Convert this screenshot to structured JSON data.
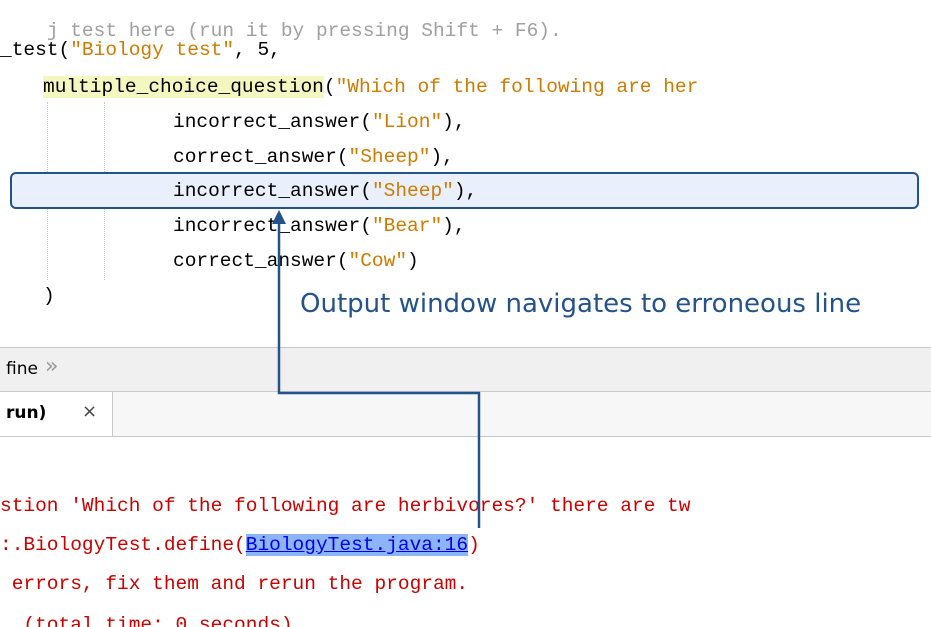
{
  "editor": {
    "cutoff_line": "j test here (run it by pressing Shift + F6).",
    "test_call_prefix": "_test(",
    "test_title": "\"Biology test\"",
    "test_args_suffix": ", 5,",
    "question_method": "multiple_choice_question",
    "question_paren": "(",
    "question_text": "\"Which of the following are her",
    "answers": [
      {
        "method": "incorrect_answer(",
        "value": "\"Lion\"",
        "suffix": "),"
      },
      {
        "method": "correct_answer(",
        "value": "\"Sheep\"",
        "suffix": "),"
      },
      {
        "method": "incorrect_answer(",
        "value": "\"Sheep\"",
        "suffix": "),"
      },
      {
        "method": "incorrect_answer(",
        "value": "\"Bear\"",
        "suffix": "),"
      },
      {
        "method": "correct_answer(",
        "value": "\"Cow\"",
        "suffix": ")"
      }
    ],
    "closing_paren": ")"
  },
  "annotation": {
    "callout": "Output window navigates to erroneous line",
    "color": "#23538a"
  },
  "breadcrumb": {
    "label": "fine",
    "chevron": "»"
  },
  "output_tab": {
    "label": "run)",
    "close_icon": "×"
  },
  "output": {
    "line1": "stion 'Which of the following are herbivores?' there are tw",
    "line2_prefix": ":.BiologyTest.define(",
    "line2_link": "BiologyTest.java:16",
    "line2_suffix": ")",
    "line3": " errors, fix them and rerun the program.",
    "line4": "  (total time: 0 seconds)"
  },
  "colors": {
    "error_text": "#cc0000",
    "string_literal": "#ce7b00",
    "method_highlight": "#f5f7c0",
    "link_highlight": "#8db4f6",
    "line_highlight": "#e9effb"
  }
}
